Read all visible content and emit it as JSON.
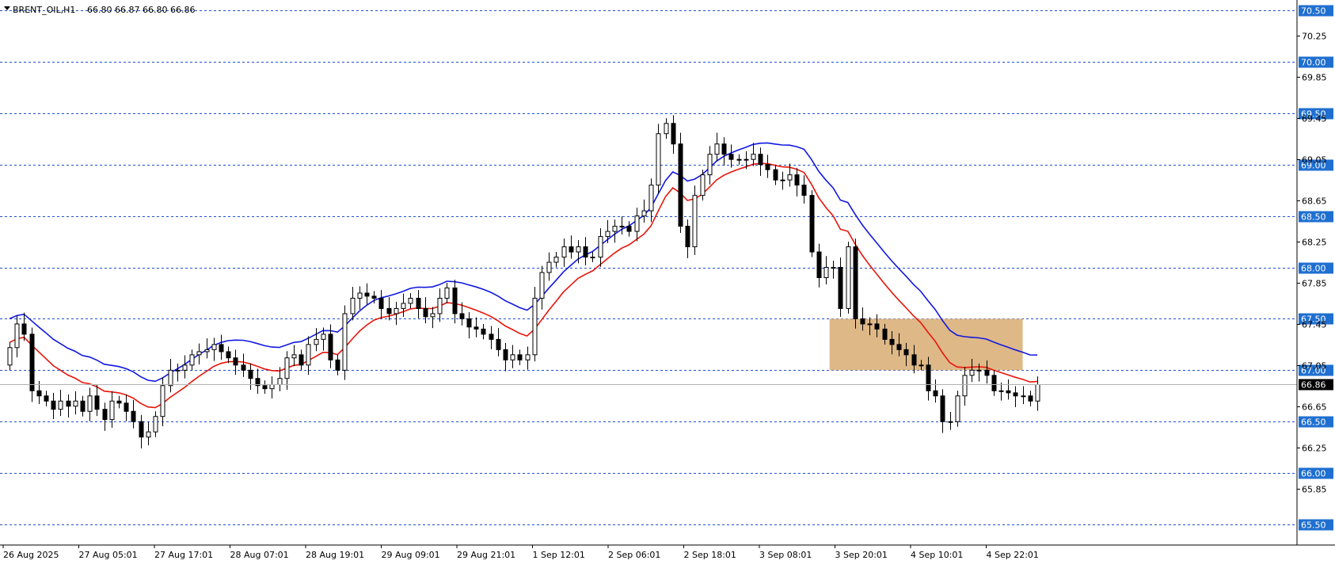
{
  "header": {
    "symbol": "BRENT_OIL,H1",
    "ohlc": "66.80 66.87 66.80 66.86"
  },
  "colors": {
    "level_line": "#1f4fd0",
    "badge": "#1f6fd0",
    "ma_fast": "#e8150a",
    "ma_slow": "#1018e0",
    "zone_fill": "#deb887",
    "current_badge": "#000000",
    "candle_up_fill": "#ffffff",
    "candle_down_fill": "#000000"
  },
  "chart_data": {
    "type": "candlestick",
    "ylim": [
      65.3,
      70.6
    ],
    "y_ticks": [
      "70.25",
      "69.85",
      "69.45",
      "69.05",
      "68.65",
      "68.25",
      "67.85",
      "67.45",
      "67.05",
      "66.65",
      "66.25",
      "65.85"
    ],
    "levels": [
      "70.50",
      "70.00",
      "69.50",
      "69.00",
      "68.50",
      "68.00",
      "67.50",
      "67.00",
      "66.50",
      "66.00",
      "65.50"
    ],
    "current_price": "66.86",
    "x_labels": [
      "26 Aug 2025",
      "27 Aug 05:01",
      "27 Aug 17:01",
      "28 Aug 07:01",
      "28 Aug 19:01",
      "29 Aug 09:01",
      "29 Aug 21:01",
      "1 Sep 12:01",
      "2 Sep 06:01",
      "2 Sep 18:01",
      "3 Sep 08:01",
      "3 Sep 20:01",
      "4 Sep 10:01",
      "4 Sep 22:01"
    ],
    "candle_close": [
      67.22,
      67.45,
      67.35,
      66.8,
      66.75,
      66.7,
      66.62,
      66.7,
      66.65,
      66.7,
      66.6,
      66.75,
      66.62,
      66.52,
      66.7,
      66.68,
      66.6,
      66.5,
      66.35,
      66.4,
      66.55,
      66.85,
      67.0,
      67.0,
      67.05,
      67.15,
      67.18,
      67.2,
      67.25,
      67.18,
      67.12,
      67.05,
      67.0,
      66.92,
      66.85,
      66.82,
      66.86,
      66.92,
      67.12,
      67.15,
      67.05,
      67.25,
      67.3,
      67.35,
      67.1,
      67.0,
      67.55,
      67.7,
      67.75,
      67.72,
      67.7,
      67.6,
      67.55,
      67.6,
      67.65,
      67.7,
      67.6,
      67.52,
      67.55,
      67.7,
      67.8,
      67.55,
      67.5,
      67.42,
      67.4,
      67.35,
      67.3,
      67.2,
      67.1,
      67.15,
      67.1,
      67.15,
      67.7,
      67.95,
      68.05,
      68.1,
      68.2,
      68.15,
      68.2,
      68.1,
      68.1,
      68.3,
      68.35,
      68.4,
      68.4,
      68.35,
      68.5,
      68.55,
      68.8,
      69.3,
      69.4,
      69.2,
      68.4,
      68.2,
      68.7,
      68.9,
      69.1,
      69.2,
      69.1,
      69.05,
      69.05,
      69.05,
      69.1,
      69.0,
      68.95,
      68.85,
      68.85,
      68.9,
      68.8,
      68.7,
      68.15,
      67.9,
      68.0,
      68.0,
      67.6,
      68.2,
      67.5,
      67.45,
      67.45,
      67.4,
      67.3,
      67.25,
      67.2,
      67.15,
      67.05,
      67.05,
      66.8,
      66.75,
      66.5,
      66.5,
      66.75,
      66.95,
      67.0,
      67.0,
      66.95,
      66.8,
      66.8,
      66.78,
      66.75,
      66.75,
      66.7,
      66.86
    ],
    "ma_fast_values": "computed by the chart",
    "zone": {
      "from_bar": 112,
      "to_bar": 136,
      "low": 67.0,
      "high": 67.5
    }
  }
}
